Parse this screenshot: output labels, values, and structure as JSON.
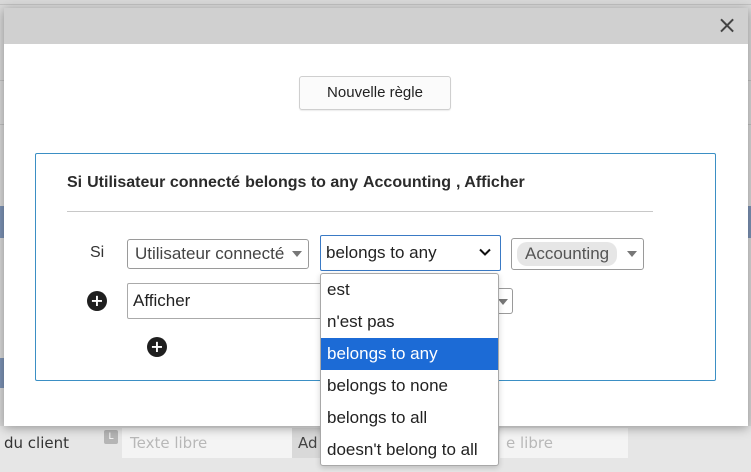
{
  "background": {
    "row_label": "du client",
    "badge": "L",
    "input_placeholder_1": "Texte libre",
    "cell_ad": "Ad",
    "input_placeholder_2": "e libre"
  },
  "modal": {
    "close_label": "×",
    "new_rule_label": "Nouvelle règle",
    "rule": {
      "summary": {
        "si": "Si",
        "field": "Utilisateur connecté",
        "operator": "belongs to any",
        "value": "Accounting",
        "action": ", Afficher"
      },
      "condition_label": "Si",
      "field_select": "Utilisateur connecté",
      "operator_select": "belongs to any",
      "value_chip": "Accounting",
      "action_select": "Afficher"
    }
  },
  "operator_dropdown": {
    "selected": "belongs to any",
    "options": [
      "est",
      "n'est pas",
      "belongs to any",
      "belongs to none",
      "belongs to all",
      "doesn't belong to all"
    ]
  },
  "colors": {
    "accent": "#1c6bd6",
    "card_border": "#3b8fc4"
  },
  "icons": {
    "close": "close-icon",
    "add": "plus-circle-icon",
    "dropdown": "caret-down-icon",
    "chevron": "chevron-down-icon"
  }
}
